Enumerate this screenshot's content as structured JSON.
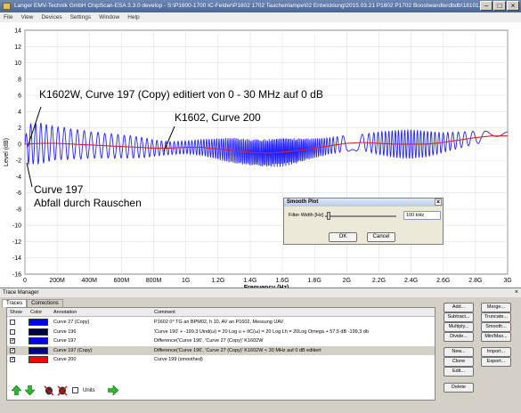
{
  "window": {
    "title": "Langer EMV-Technik GmbH ChipScan-ESA 3.3.0 develop  -  S:\\P1600-1700 IC-Felder\\P1602 1702 Tauchenlampe\\02 Entwicklung\\2015.03.21 P1602 P1702 Boostwandlerdbdb\\18101..."
  },
  "menu": [
    "File",
    "View",
    "Devices",
    "Settings",
    "Window",
    "Help"
  ],
  "annotations": {
    "a1": "K1602W, Curve 197 (Copy) editiert von 0 - 30 MHz auf 0 dB",
    "a2": "K1602, Curve 200",
    "a3": "Curve 197",
    "a4": "Abfall durch Rauschen"
  },
  "dialog": {
    "title": "Smooth Plot",
    "filter_label": "Filter Width [Hz]",
    "filter_value": "100 kHz",
    "ok": "OK",
    "cancel": "Cancel"
  },
  "trace_manager": {
    "title": "Trace Manager",
    "tabs": [
      "Traces",
      "Corrections"
    ],
    "headers": {
      "show": "Show",
      "color": "Color",
      "annotation": "Annotation",
      "comment": "Comment"
    },
    "rows": [
      {
        "checked": false,
        "color": "#0000ff",
        "annotation": "Curve 27  (Copy)",
        "comment": "P1602   0°   TG an BPM02,   h 10, AV an P1602,                          Messung UAV",
        "selected": false
      },
      {
        "checked": false,
        "color": "#000040",
        "annotation": "Curve 196",
        "comment": "'Curve 190' + -199.3              Uind(ω) = 20 Log u + IIC(ω) = 20 Log Lh   = 20Log Omega +  57,5 dB -199,3 db",
        "selected": false
      },
      {
        "checked": true,
        "color": "#0000ff",
        "annotation": "Curve 197",
        "comment": "Difference('Curve 196', 'Curve 27 (Copy)'   K1602W",
        "selected": false
      },
      {
        "checked": true,
        "color": "#000080",
        "annotation": "Curve 197 (Copy)",
        "comment": "Difference('Curve 196', 'Curve 27 (Copy)'   K1602W  < 30 MHz auf 0 dB editiert",
        "selected": true
      },
      {
        "checked": true,
        "color": "#ff0000",
        "annotation": "Curve 200",
        "comment": "Curve 199 (smoothed)",
        "selected": false
      }
    ],
    "buttons_col1": [
      "Add...",
      "Subtract...",
      "Multiply...",
      "Divide...",
      "New...",
      "Clone",
      "Edit...",
      "Delete"
    ],
    "buttons_col2": [
      "Merge...",
      "Truncate...",
      "Smooth...",
      "Min/Max...",
      "Import...",
      "Export..."
    ],
    "units_label": "Units"
  },
  "chart_data": {
    "type": "line",
    "title": "",
    "xlabel": "Frequency (Hz)",
    "ylabel": "Level (dB)",
    "xlim": [
      0,
      3000
    ],
    "ylim": [
      -16,
      14
    ],
    "x_tick_labels": [
      "0",
      "200M",
      "400M",
      "600M",
      "800M",
      "1G",
      "1.2G",
      "1.4G",
      "1.6G",
      "1.8G",
      "2G",
      "2.2G",
      "2.4G",
      "2.6G",
      "2.8G",
      "3G"
    ],
    "y_tick_labels": [
      "14",
      "12",
      "10",
      "8",
      "6",
      "4",
      "2",
      "0",
      "-2",
      "-4",
      "-6",
      "-8",
      "-10",
      "-12",
      "-14",
      "-16"
    ],
    "grid": true,
    "series": [
      {
        "name": "Curve 197",
        "color": "#2222ff",
        "x": [
          0,
          20,
          60,
          100,
          150,
          200,
          250,
          300,
          350,
          400,
          450,
          500,
          550,
          600,
          650,
          700,
          750,
          800,
          850,
          900,
          950,
          1000,
          1100,
          1200,
          1300,
          1400,
          1500,
          1600,
          1700,
          1800,
          1900,
          2000,
          2100,
          2200,
          2300,
          2400,
          2500,
          2600,
          2700,
          2800,
          2900,
          3000
        ],
        "amplitude": [
          0.5,
          2.5,
          2.5,
          2.5,
          2.2,
          2.0,
          2.0,
          1.8,
          1.8,
          1.6,
          1.6,
          1.5,
          1.5,
          1.4,
          1.4,
          1.3,
          1.2,
          1.0,
          0.9,
          0.8,
          0.8,
          0.8,
          1.0,
          1.3,
          1.6,
          1.6,
          1.7,
          1.8,
          1.5,
          1.2,
          1.0,
          1.0,
          1.0,
          1.4,
          1.7,
          1.8,
          1.6,
          1.2,
          1.0,
          0.8,
          0.6,
          0.5
        ]
      },
      {
        "name": "Curve 200",
        "color": "#e02020",
        "x": [
          0,
          100,
          200,
          300,
          400,
          500,
          600,
          700,
          800,
          900,
          1000,
          1100,
          1200,
          1300,
          1400,
          1500,
          1600,
          1700,
          1800,
          1900,
          2000,
          2100,
          2200,
          2300,
          2400,
          2500,
          2600,
          2700,
          2800,
          2900,
          3000
        ],
        "y": [
          0,
          0.1,
          0.1,
          0.0,
          -0.1,
          -0.2,
          -0.3,
          -0.4,
          -0.5,
          -0.5,
          -0.4,
          -0.4,
          -0.6,
          -0.8,
          -1.0,
          -1.1,
          -1.0,
          -0.8,
          -0.5,
          -0.2,
          0.1,
          0.2,
          0.1,
          0.0,
          0.0,
          0.0,
          0.2,
          0.5,
          0.8,
          1.0,
          1.0
        ]
      }
    ]
  }
}
